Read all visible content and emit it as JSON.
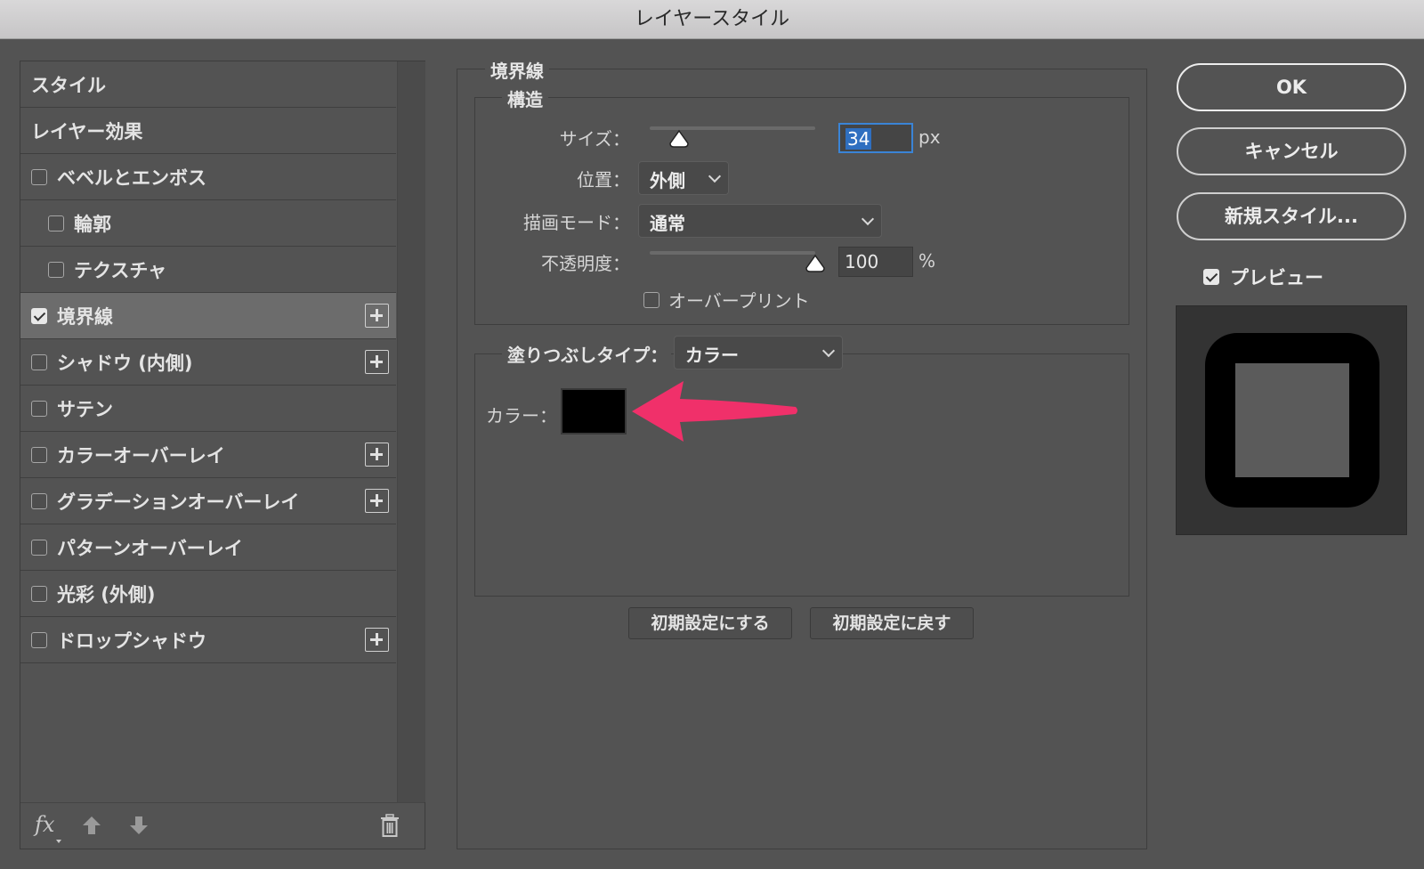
{
  "window": {
    "title": "レイヤースタイル"
  },
  "style_list": [
    {
      "label": "スタイル",
      "type": "plain"
    },
    {
      "label": "レイヤー効果",
      "type": "plain"
    },
    {
      "label": "ベベルとエンボス",
      "type": "check",
      "checked": false,
      "level": 0,
      "plus": false
    },
    {
      "label": "輪郭",
      "type": "check",
      "checked": false,
      "level": 1,
      "plus": false
    },
    {
      "label": "テクスチャ",
      "type": "check",
      "checked": false,
      "level": 1,
      "plus": false
    },
    {
      "label": "境界線",
      "type": "check",
      "checked": true,
      "level": 0,
      "plus": true,
      "active": true
    },
    {
      "label": "シャドウ (内側)",
      "type": "check",
      "checked": false,
      "level": 0,
      "plus": true
    },
    {
      "label": "サテン",
      "type": "check",
      "checked": false,
      "level": 0,
      "plus": false
    },
    {
      "label": "カラーオーバーレイ",
      "type": "check",
      "checked": false,
      "level": 0,
      "plus": true
    },
    {
      "label": "グラデーションオーバーレイ",
      "type": "check",
      "checked": false,
      "level": 0,
      "plus": true
    },
    {
      "label": "パターンオーバーレイ",
      "type": "check",
      "checked": false,
      "level": 0,
      "plus": false
    },
    {
      "label": "光彩 (外側)",
      "type": "check",
      "checked": false,
      "level": 0,
      "plus": false
    },
    {
      "label": "ドロップシャドウ",
      "type": "check",
      "checked": false,
      "level": 0,
      "plus": true
    }
  ],
  "footer_icons": {
    "fx": "fx",
    "up": "arrow-up-icon",
    "down": "arrow-down-icon",
    "trash": "trash-icon"
  },
  "stroke": {
    "section_title": "境界線",
    "structure_title": "構造",
    "size_label": "サイズ：",
    "size_value": "34",
    "size_unit": "px",
    "size_slider_fraction": 0.18,
    "position_label": "位置：",
    "position_value": "外側",
    "blend_label": "描画モード：",
    "blend_value": "通常",
    "opacity_label": "不透明度：",
    "opacity_value": "100",
    "opacity_unit": "%",
    "opacity_slider_fraction": 1.0,
    "overprint_label": "オーバープリント",
    "overprint_checked": false,
    "fill_type_label": "塗りつぶしタイプ：",
    "fill_type_value": "カラー",
    "color_label": "カラー：",
    "color_value": "#000000",
    "reset_default_label": "初期設定にする",
    "restore_default_label": "初期設定に戻す"
  },
  "annotation": {
    "arrow_color": "#f0306a"
  },
  "buttons": {
    "ok": "OK",
    "cancel": "キャンセル",
    "new_style": "新規スタイル..."
  },
  "preview": {
    "label": "プレビュー",
    "checked": true
  }
}
